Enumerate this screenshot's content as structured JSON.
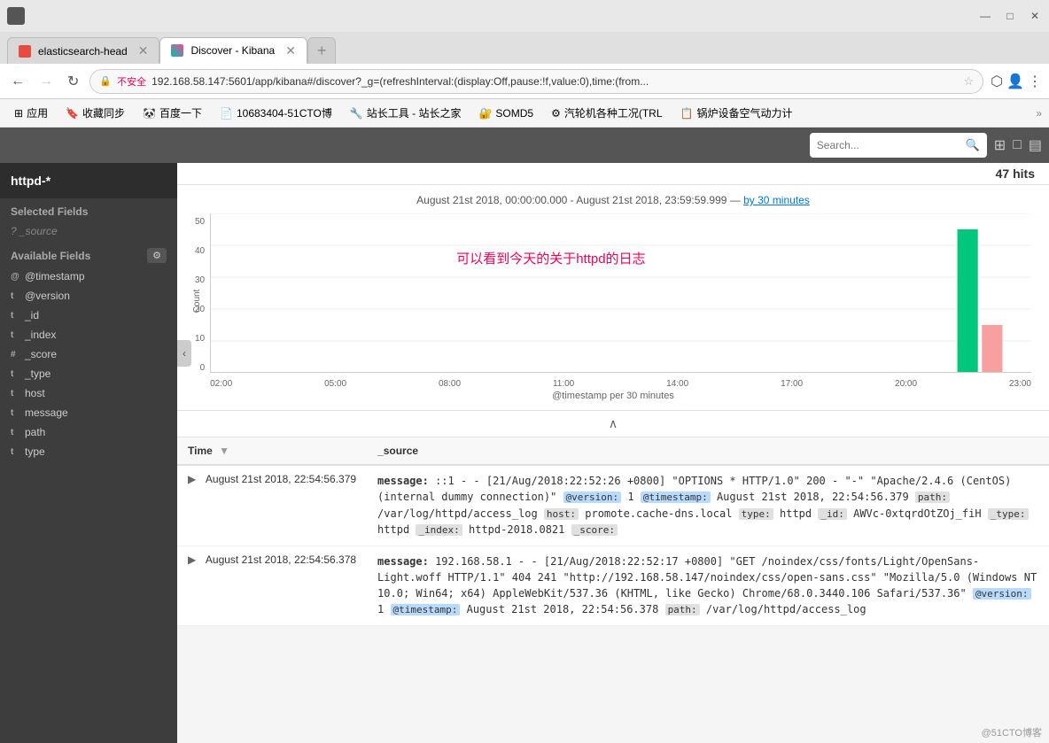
{
  "browser": {
    "title_bar": {
      "minimize": "—",
      "maximize": "□",
      "close": "✕"
    },
    "tabs": [
      {
        "id": "tab-elasticsearch",
        "label": "elasticsearch-head",
        "icon_color": "#e84b40",
        "active": false
      },
      {
        "id": "tab-kibana",
        "label": "Discover - Kibana",
        "icon_color": "#00bfb3",
        "active": true
      },
      {
        "id": "tab-new",
        "label": "",
        "active": false
      }
    ],
    "address": {
      "security_label": "不安全",
      "url": "192.168.58.147:5601/app/kibana#/discover?_g=(refreshInterval:(display:Off,pause:!f,value:0),time:(from..."
    },
    "bookmarks": [
      {
        "label": "应用",
        "icon": "⊞"
      },
      {
        "label": "收藏同步",
        "icon": "🔖"
      },
      {
        "label": "百度一下",
        "icon": "🔍"
      },
      {
        "label": "10683404-51CTO博",
        "icon": "📄"
      },
      {
        "label": "站长工具 - 站长之家",
        "icon": "🔧"
      },
      {
        "label": "SOMD5",
        "icon": "🔐"
      },
      {
        "label": "汽轮机各种工况(TRL",
        "icon": "⚙"
      },
      {
        "label": "锅炉设备空气动力计",
        "icon": "📋"
      }
    ]
  },
  "sidebar": {
    "index_pattern": "httpd-*",
    "collapse_icon": "‹",
    "selected_fields_label": "Selected Fields",
    "source_field": "? _source",
    "available_fields_label": "Available Fields",
    "gear_icon": "⚙",
    "fields": [
      {
        "type": "@",
        "name": "@timestamp"
      },
      {
        "type": "t",
        "name": "@version"
      },
      {
        "type": "t",
        "name": "_id"
      },
      {
        "type": "t",
        "name": "_index"
      },
      {
        "type": "#",
        "name": "_score"
      },
      {
        "type": "t",
        "name": "_type"
      },
      {
        "type": "t",
        "name": "host"
      },
      {
        "type": "t",
        "name": "message"
      },
      {
        "type": "t",
        "name": "path"
      },
      {
        "type": "t",
        "name": "type"
      }
    ]
  },
  "search_bar": {
    "placeholder": "Search...",
    "search_icon": "🔍"
  },
  "main": {
    "hits_count": "47 hits",
    "chart": {
      "time_range": "August 21st 2018, 00:00:00.000 - August 21st 2018, 23:59:59.999",
      "separator": "—",
      "interval_link": "by 30 minutes",
      "annotation": "可以看到今天的关于httpd的日志",
      "y_axis_labels": [
        "50",
        "40",
        "30",
        "20",
        "10",
        "0"
      ],
      "x_axis_labels": [
        "02:00",
        "05:00",
        "08:00",
        "11:00",
        "14:00",
        "17:00",
        "20:00",
        "23:00"
      ],
      "x_label": "@timestamp per 30 minutes",
      "y_label": "Count",
      "bar_data": [
        {
          "x_pct": 91,
          "height_pct": 90,
          "color": "#00c77b"
        },
        {
          "x_pct": 94,
          "height_pct": 30,
          "color": "#f8a9a9"
        }
      ]
    },
    "collapse_btn": "∧",
    "table": {
      "columns": [
        {
          "label": "Time",
          "sort_icon": "▼"
        },
        {
          "label": "_source",
          "sort_icon": ""
        }
      ],
      "rows": [
        {
          "time": "August 21st 2018, 22:54:56.379",
          "source_raw": "message: ::1 - - [21/Aug/2018:22:52:26 +0800] \"OPTIONS * HTTP/1.0\" 200 - \"-\" \"Apache/2.4.6 (CentOS) (internal dummy connection)\" @version: 1 @timestamp: August 21st 2018, 22:54:56.379 path: /var/log/httpd/access_log host: promote.cache-dns.local type: httpd _id: AWVc-0xtqrdOtZOj_fiH _type: httpd _index: httpd-2018.0821 _score:",
          "tags": [
            {
              "text": "message:",
              "style": "bold"
            },
            {
              "text": "::1 - - [21/Aug/2018:22:52:26 +0800] \"OPTIONS * HTTP/1.0\" 200 - \"-\"",
              "style": "normal"
            },
            {
              "text": "\"Apache/2.4.6 (CentOS) (internal dummy connection)\"",
              "style": "normal"
            },
            {
              "text": "@version:",
              "style": "tag-blue"
            },
            {
              "text": "1",
              "style": "normal"
            },
            {
              "text": "@timestamp:",
              "style": "tag-blue"
            },
            {
              "text": "August 21st 2018, 22:54:56.379",
              "style": "normal"
            },
            {
              "text": "path:",
              "style": "tag-gray"
            },
            {
              "text": "/var/log/httpd/access_log",
              "style": "normal"
            },
            {
              "text": "host:",
              "style": "tag-gray"
            },
            {
              "text": "promote.cache-dns.local",
              "style": "normal"
            },
            {
              "text": "type:",
              "style": "tag-gray"
            },
            {
              "text": "httpd",
              "style": "normal"
            },
            {
              "text": "_id:",
              "style": "tag-gray"
            },
            {
              "text": "AWVc-0xtqrdOtZOj_fiH",
              "style": "normal"
            },
            {
              "text": "_type:",
              "style": "tag-gray"
            },
            {
              "text": "httpd",
              "style": "normal"
            },
            {
              "text": "_index:",
              "style": "tag-gray"
            },
            {
              "text": "httpd-2018.0821",
              "style": "normal"
            },
            {
              "text": "_score:",
              "style": "tag-gray"
            }
          ]
        },
        {
          "time": "August 21st 2018, 22:54:56.378",
          "source_raw": "message: 192.168.58.1 - - [21/Aug/2018:22:52:17 +0800] \"GET /noindex/css/fonts/Light/OpenSans-Light.woff HTTP/1.1\" 404 241 \"http://192.168.58.147/noindex/css/open-sans.css\" \"Mozilla/5.0 (Windows NT 10.0; Win64; x64) AppleWebKit/537.36 (KHTML, like Gecko) Chrome/68.0.3440.106 Safari/537.36\" @version: 1 @timestamp: August 21st 2018, 22:54:56.378 path: /var/log/httpd/access_log",
          "tags": [
            {
              "text": "message:",
              "style": "bold"
            },
            {
              "text": "192.168.58.1 - - [21/Aug/2018:22:52:17 +0800] \"GET /noindex/css/fonts/Light/OpenSans-Light.woff HTTP/1.1\" 404 241 \"http://192.168.58.147/noindex/css/open-sans.css\" \"Mozilla/5.0 (Windows NT 10.0; Win64; x64) AppleWebKit/537.36 (KHTML, like Gecko) Chrome/68.0.3440.106 Safari/537.36\"",
              "style": "normal"
            },
            {
              "text": "@version:",
              "style": "tag-blue"
            },
            {
              "text": "1",
              "style": "normal"
            },
            {
              "text": "@timestamp:",
              "style": "tag-blue"
            },
            {
              "text": "August 21st 2018, 22:54:56.378",
              "style": "normal"
            },
            {
              "text": "path:",
              "style": "tag-gray"
            },
            {
              "text": "/var/log/httpd/access_log",
              "style": "normal"
            }
          ]
        }
      ]
    }
  },
  "watermark": "@51CTO博客"
}
